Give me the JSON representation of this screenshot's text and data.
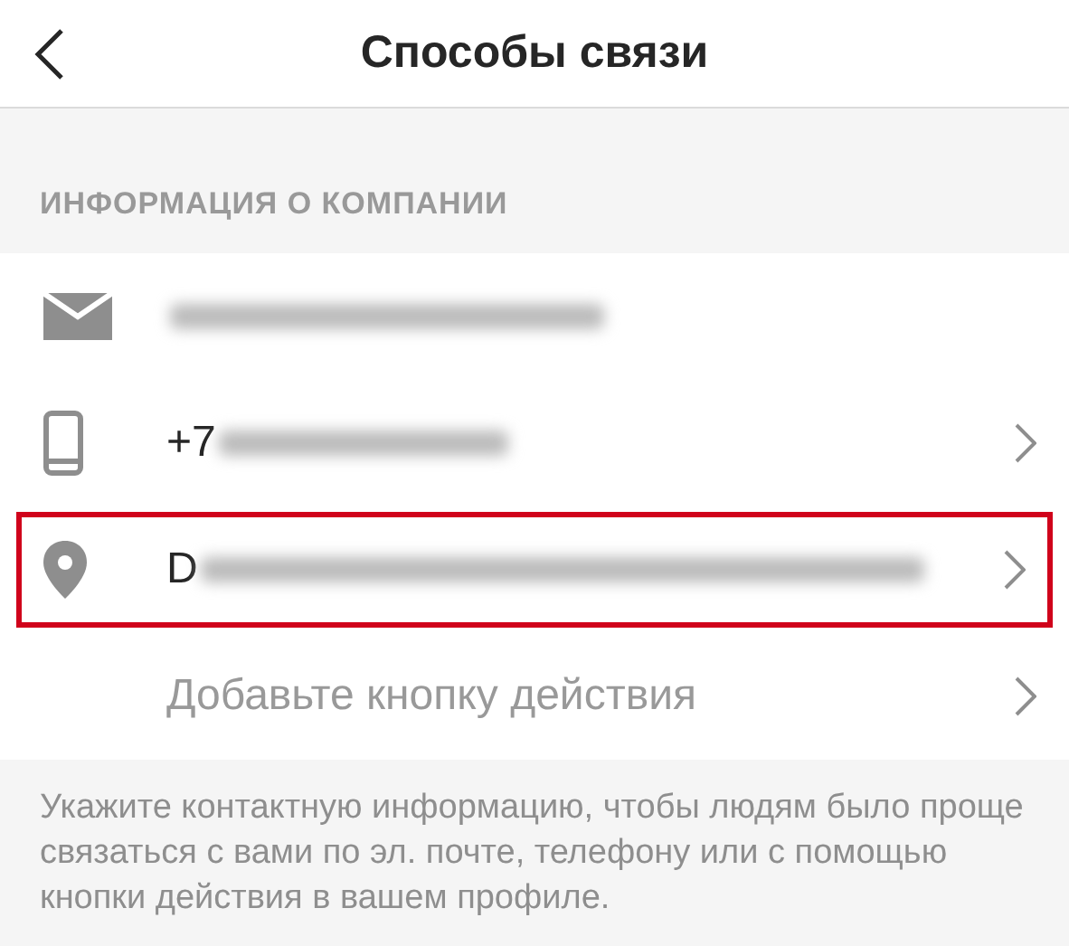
{
  "header": {
    "title": "Способы связи"
  },
  "section": {
    "title": "ИНФОРМАЦИЯ О КОМПАНИИ"
  },
  "rows": [
    {
      "kind": "email",
      "chevron": false,
      "highlighted": false
    },
    {
      "kind": "phone",
      "text": "+7",
      "chevron": true,
      "highlighted": false
    },
    {
      "kind": "location",
      "text": "D",
      "chevron": true,
      "highlighted": true
    },
    {
      "kind": "action",
      "text": "Добавьте кнопку действия",
      "chevron": true,
      "highlighted": false
    }
  ],
  "footer": {
    "text": "Укажите контактную информацию, чтобы людям было проще связаться с вами по эл. почте, телефону или с помощью кнопки действия в вашем профиле."
  }
}
